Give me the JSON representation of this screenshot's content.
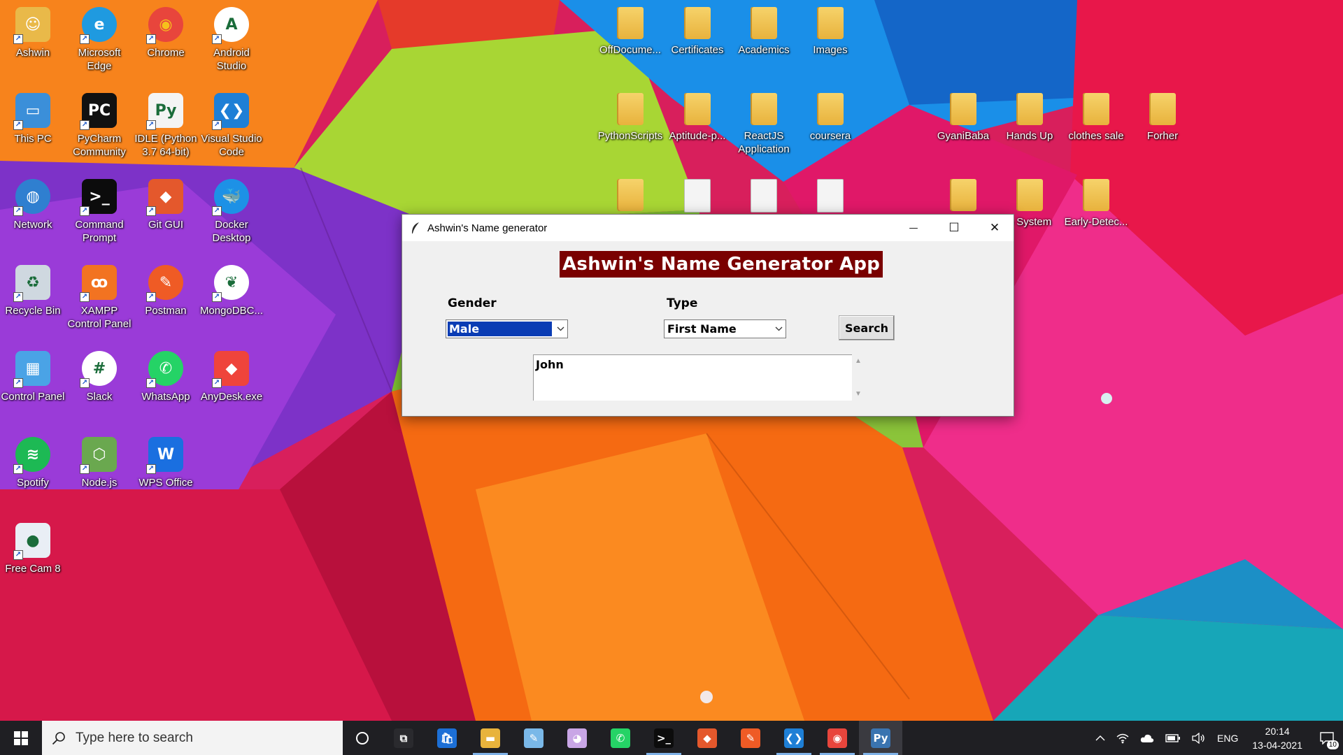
{
  "desktop": {
    "icons": [
      {
        "label": "Ashwin",
        "icon": "user-folder-icon",
        "color": "#e9b949"
      },
      {
        "label": "Microsoft Edge",
        "icon": "edge-icon",
        "color": "#1f9ae0"
      },
      {
        "label": "Chrome",
        "icon": "chrome-icon",
        "color": "#e8453c"
      },
      {
        "label": "Android Studio",
        "icon": "android-studio-icon",
        "color": "#ffffff"
      },
      {
        "label": "This PC",
        "icon": "computer-icon",
        "color": "#3b8fd9"
      },
      {
        "label": "PyCharm Community",
        "icon": "pycharm-icon",
        "color": "#111111"
      },
      {
        "label": "IDLE (Python 3.7 64-bit)",
        "icon": "python-file-icon",
        "color": "#f4f4f4"
      },
      {
        "label": "Visual Studio Code",
        "icon": "vscode-icon",
        "color": "#1e7fd6"
      },
      {
        "label": "Network",
        "icon": "network-icon",
        "color": "#2f7fd0"
      },
      {
        "label": "Command Prompt",
        "icon": "terminal-icon",
        "color": "#0c0c0c"
      },
      {
        "label": "Git GUI",
        "icon": "git-icon",
        "color": "#e4582c"
      },
      {
        "label": "Docker Desktop",
        "icon": "docker-icon",
        "color": "#1d91e6"
      },
      {
        "label": "Recycle Bin",
        "icon": "recycle-bin-icon",
        "color": "#cfd8e0"
      },
      {
        "label": "XAMPP Control Panel",
        "icon": "xampp-icon",
        "color": "#f27321"
      },
      {
        "label": "Postman",
        "icon": "postman-icon",
        "color": "#ef5b25"
      },
      {
        "label": "MongoDBC...",
        "icon": "mongodb-icon",
        "color": "#ffffff"
      },
      {
        "label": "Control Panel",
        "icon": "control-panel-icon",
        "color": "#4aa3e6"
      },
      {
        "label": "Slack",
        "icon": "slack-icon",
        "color": "#ffffff"
      },
      {
        "label": "WhatsApp",
        "icon": "whatsapp-icon",
        "color": "#25d366"
      },
      {
        "label": "AnyDesk.exe",
        "icon": "anydesk-icon",
        "color": "#ef443b"
      },
      {
        "label": "Spotify",
        "icon": "spotify-icon",
        "color": "#1db954"
      },
      {
        "label": "Node.js",
        "icon": "nodejs-icon",
        "color": "#6aa84f"
      },
      {
        "label": "WPS Office",
        "icon": "wps-office-icon",
        "color": "#1a6fe0"
      },
      {
        "label": "Free Cam 8",
        "icon": "freecam-icon",
        "color": "#e9eef5"
      },
      {
        "label": "OffDocume...",
        "icon": "folder-icon",
        "color": "#f1c85a"
      },
      {
        "label": "Certificates",
        "icon": "folder-icon",
        "color": "#f1c85a"
      },
      {
        "label": "Academics",
        "icon": "folder-icon",
        "color": "#f1c85a"
      },
      {
        "label": "Images",
        "icon": "folder-icon",
        "color": "#f1c85a"
      },
      {
        "label": "PythonScripts",
        "icon": "folder-icon",
        "color": "#f1c85a"
      },
      {
        "label": "Aptitude-p...",
        "icon": "folder-icon",
        "color": "#f1c85a"
      },
      {
        "label": "ReactJS Application",
        "icon": "folder-icon",
        "color": "#f1c85a"
      },
      {
        "label": "coursera",
        "icon": "folder-icon",
        "color": "#f1c85a"
      },
      {
        "label": "GyaniBaba",
        "icon": "folder-icon",
        "color": "#f1c85a"
      },
      {
        "label": "Hands Up",
        "icon": "folder-icon",
        "color": "#f1c85a"
      },
      {
        "label": "clothes sale",
        "icon": "folder-icon",
        "color": "#f1c85a"
      },
      {
        "label": "Forher",
        "icon": "folder-icon",
        "color": "#f1c85a"
      },
      {
        "label": "",
        "icon": "folder-icon",
        "color": "#f1c85a"
      },
      {
        "label": "",
        "icon": "file-icon",
        "color": "#f4f4f4"
      },
      {
        "label": "",
        "icon": "file-icon",
        "color": "#f4f4f4"
      },
      {
        "label": "",
        "icon": "file-icon",
        "color": "#f4f4f4"
      },
      {
        "label": "",
        "icon": "folder-icon",
        "color": "#f1c85a"
      },
      {
        "label": "b System",
        "icon": "folder-icon",
        "color": "#f1c85a"
      },
      {
        "label": "Early-Detec...",
        "icon": "folder-icon",
        "color": "#f1c85a"
      }
    ]
  },
  "window": {
    "title": "Ashwin's Name generator",
    "heading": "Ashwin's Name Generator App",
    "heading_bg": "#7a0000",
    "gender_label": "Gender",
    "gender_value": "Male",
    "type_label": "Type",
    "type_value": "First Name",
    "search_label": "Search",
    "result": "John",
    "minimize_glyph": "—",
    "maximize_glyph": "☐",
    "close_glyph": "✕"
  },
  "taskbar": {
    "search_placeholder": "Type here to search",
    "apps": [
      {
        "name": "Task View",
        "icon": "task-view-icon"
      },
      {
        "name": "Microsoft Store",
        "icon": "store-icon"
      },
      {
        "name": "File Explorer",
        "icon": "file-explorer-icon"
      },
      {
        "name": "Notepad",
        "icon": "notepad-icon"
      },
      {
        "name": "Paint",
        "icon": "paint-icon"
      },
      {
        "name": "WhatsApp",
        "icon": "whatsapp-icon"
      },
      {
        "name": "Command Prompt",
        "icon": "terminal-icon"
      },
      {
        "name": "Git GUI",
        "icon": "git-icon"
      },
      {
        "name": "Postman",
        "icon": "postman-icon"
      },
      {
        "name": "Visual Studio Code",
        "icon": "vscode-icon"
      },
      {
        "name": "Chrome",
        "icon": "chrome-icon"
      },
      {
        "name": "Python",
        "icon": "python-icon"
      }
    ],
    "language": "ENG",
    "time": "20:14",
    "date": "13-04-2021",
    "notification_count": "10"
  }
}
